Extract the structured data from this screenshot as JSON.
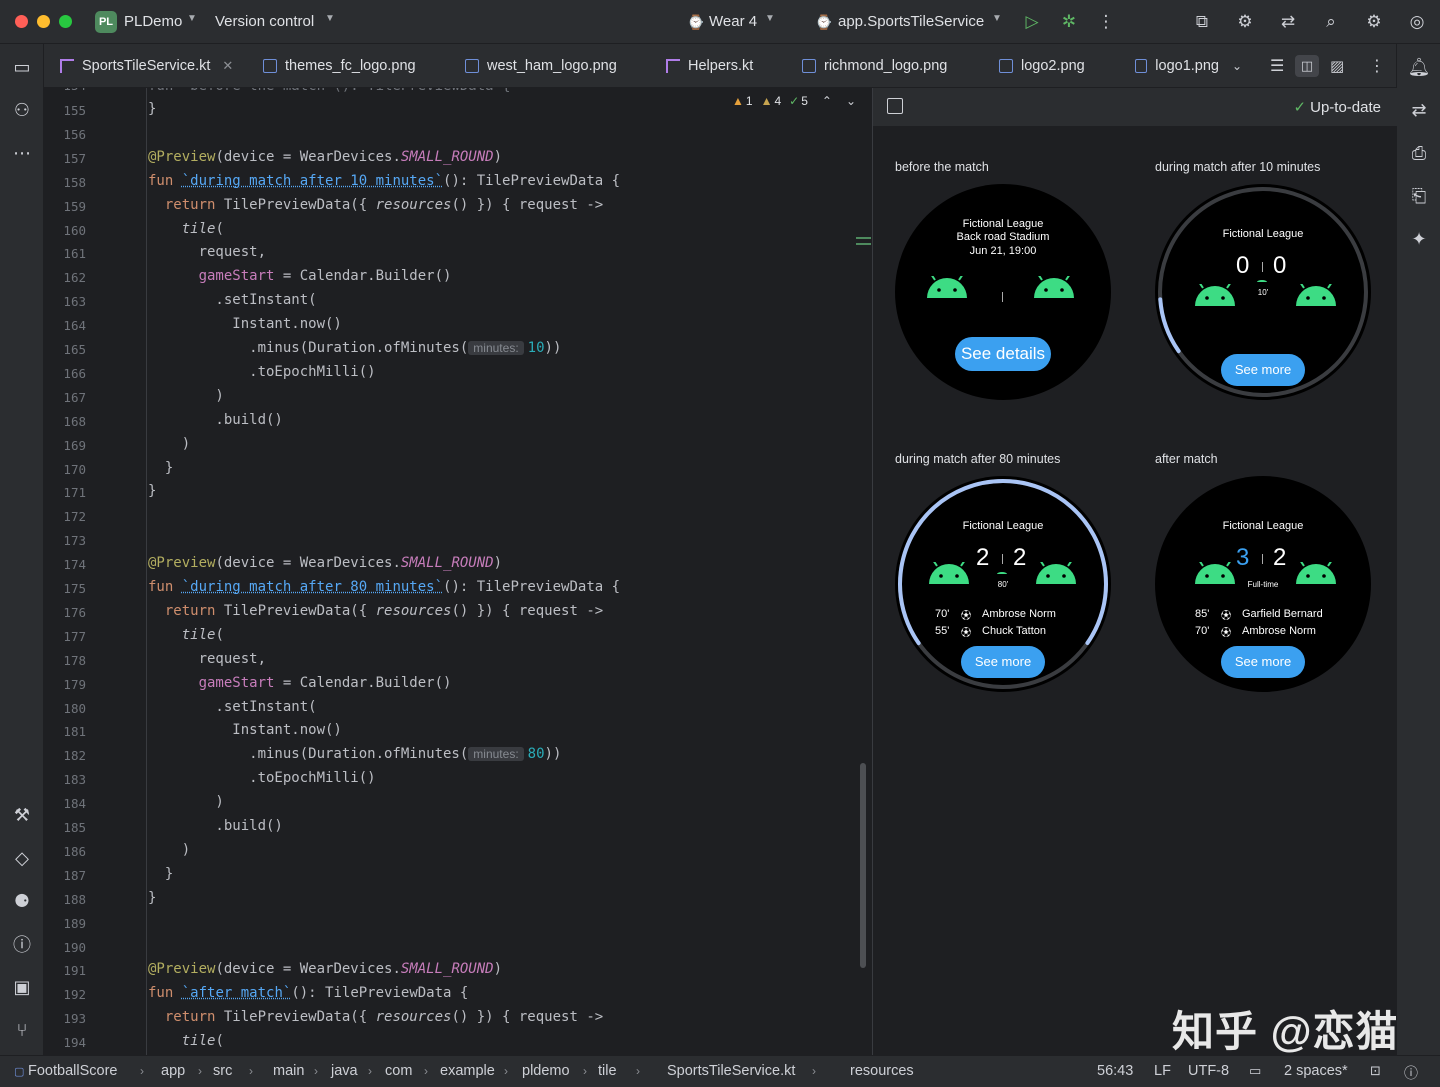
{
  "titlebar": {
    "project_badge": "PL",
    "project_name": "PLDemo",
    "vcs": "Version control",
    "device": "Wear 4",
    "run_config": "app.SportsTileService"
  },
  "tabs": [
    {
      "label": "SportsTileService.kt",
      "type": "kotlin",
      "active": true
    },
    {
      "label": "themes_fc_logo.png",
      "type": "image"
    },
    {
      "label": "west_ham_logo.png",
      "type": "image"
    },
    {
      "label": "Helpers.kt",
      "type": "kotlin"
    },
    {
      "label": "richmond_logo.png",
      "type": "image"
    },
    {
      "label": "logo2.png",
      "type": "image"
    },
    {
      "label": "logo1.png",
      "type": "image"
    }
  ],
  "inspections": {
    "errors": "1",
    "warnings": "4",
    "ok": "5"
  },
  "editor": {
    "lines": [
      {
        "n": "155",
        "t": "}"
      },
      {
        "n": "156",
        "t": ""
      },
      {
        "n": "157",
        "t": "@Preview(device = WearDevices.SMALL_ROUND)"
      },
      {
        "n": "158",
        "t": "fun `during match after 10 minutes`(): TilePreviewData {"
      },
      {
        "n": "159",
        "t": "  return TilePreviewData({ resources() }) { request ->"
      },
      {
        "n": "160",
        "t": "    tile("
      },
      {
        "n": "161",
        "t": "      request,"
      },
      {
        "n": "162",
        "t": "      gameStart = Calendar.Builder()"
      },
      {
        "n": "163",
        "t": "        .setInstant("
      },
      {
        "n": "164",
        "t": "          Instant.now()"
      },
      {
        "n": "165",
        "t": "            .minus(Duration.ofMinutes( minutes: 10))"
      },
      {
        "n": "166",
        "t": "            .toEpochMilli()"
      },
      {
        "n": "167",
        "t": "        )"
      },
      {
        "n": "168",
        "t": "        .build()"
      },
      {
        "n": "169",
        "t": "    )"
      },
      {
        "n": "170",
        "t": "  }"
      },
      {
        "n": "171",
        "t": "}"
      },
      {
        "n": "172",
        "t": ""
      },
      {
        "n": "173",
        "t": ""
      },
      {
        "n": "174",
        "t": "@Preview(device = WearDevices.SMALL_ROUND)"
      },
      {
        "n": "175",
        "t": "fun `during match after 80 minutes`(): TilePreviewData {"
      },
      {
        "n": "176",
        "t": "  return TilePreviewData({ resources() }) { request ->"
      },
      {
        "n": "177",
        "t": "    tile("
      },
      {
        "n": "178",
        "t": "      request,"
      },
      {
        "n": "179",
        "t": "      gameStart = Calendar.Builder()"
      },
      {
        "n": "180",
        "t": "        .setInstant("
      },
      {
        "n": "181",
        "t": "          Instant.now()"
      },
      {
        "n": "182",
        "t": "            .minus(Duration.ofMinutes( minutes: 80))"
      },
      {
        "n": "183",
        "t": "            .toEpochMilli()"
      },
      {
        "n": "184",
        "t": "        )"
      },
      {
        "n": "185",
        "t": "        .build()"
      },
      {
        "n": "186",
        "t": "    )"
      },
      {
        "n": "187",
        "t": "  }"
      },
      {
        "n": "188",
        "t": "}"
      },
      {
        "n": "189",
        "t": ""
      },
      {
        "n": "190",
        "t": ""
      },
      {
        "n": "191",
        "t": "@Preview(device = WearDevices.SMALL_ROUND)"
      },
      {
        "n": "192",
        "t": "fun `after match`(): TilePreviewData {"
      },
      {
        "n": "193",
        "t": "  return TilePreviewData({ resources() }) { request ->"
      },
      {
        "n": "194",
        "t": "    tile("
      }
    ]
  },
  "preview": {
    "status": "Up-to-date",
    "tiles": [
      {
        "title": "before the match",
        "league": "Fictional League",
        "venue": "Back road Stadium",
        "date": "Jun 21, 19:00",
        "button": "See details"
      },
      {
        "title": "during match after 10 minutes",
        "league": "Fictional League",
        "home_score": "0",
        "away_score": "0",
        "minute": "10'",
        "button": "See more",
        "progress": 0.11
      },
      {
        "title": "during match after 80 minutes",
        "league": "Fictional League",
        "home_score": "2",
        "away_score": "2",
        "minute": "80'",
        "scorers": [
          {
            "min": "70'",
            "name": "Ambrose Norm"
          },
          {
            "min": "55'",
            "name": "Chuck Tatton"
          }
        ],
        "button": "See more",
        "progress": 0.89
      },
      {
        "title": "after match",
        "league": "Fictional League",
        "home_score": "3",
        "away_score": "2",
        "minute": "Full-time",
        "scorers": [
          {
            "min": "85'",
            "name": "Garfield Bernard"
          },
          {
            "min": "70'",
            "name": "Ambrose Norm"
          }
        ],
        "button": "See more"
      }
    ]
  },
  "statusbar": {
    "breadcrumbs": [
      "FootballScore",
      "app",
      "src",
      "main",
      "java",
      "com",
      "example",
      "pldemo",
      "tile",
      "SportsTileService.kt",
      "resources"
    ],
    "position": "56:43",
    "line_sep": "LF",
    "encoding": "UTF-8",
    "indent": "2 spaces*"
  },
  "watermark": "知乎 @恋猫",
  "colors": {
    "accent": "#3574f0",
    "tile_button": "#3ba0f0",
    "android_green": "#3ddc84"
  }
}
